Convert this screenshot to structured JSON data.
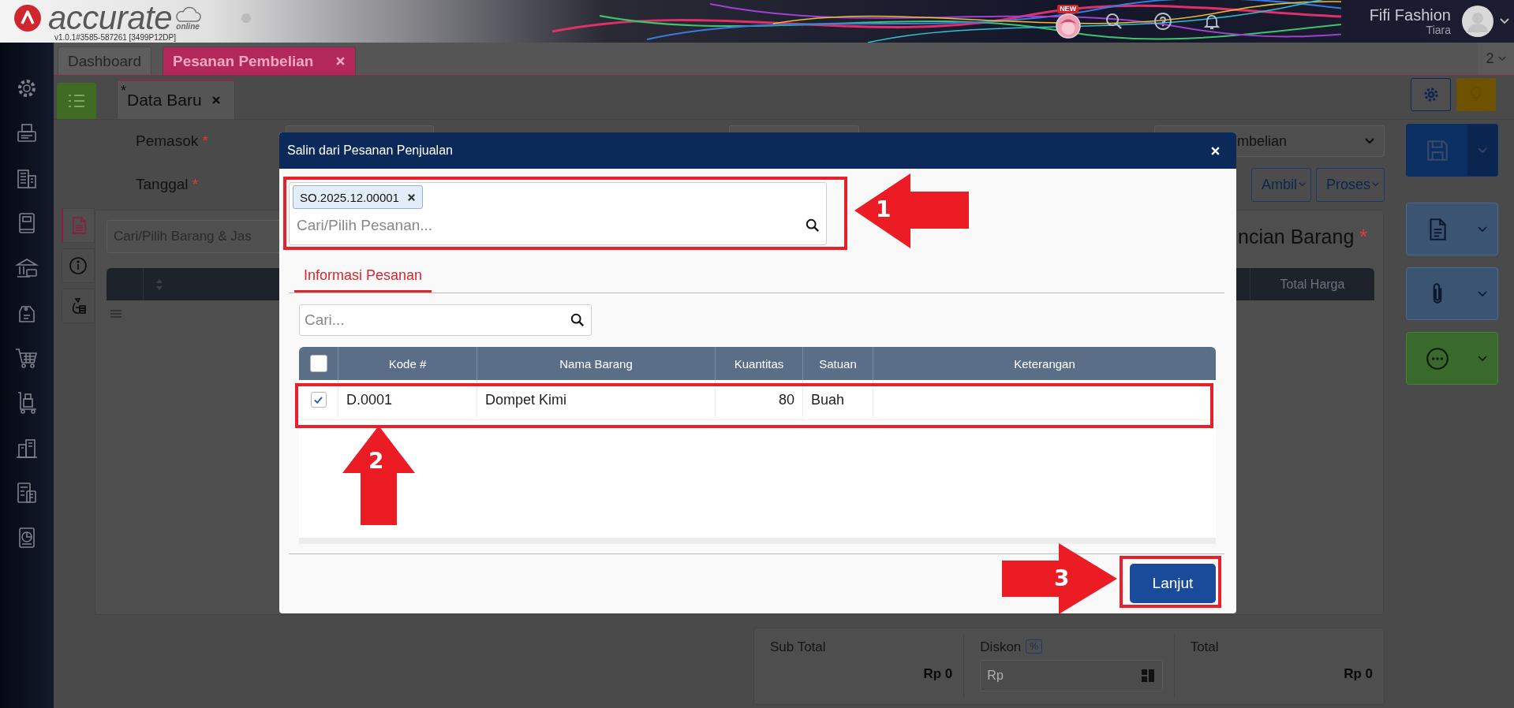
{
  "header": {
    "logo": "accurate",
    "logo_tagline": "online",
    "version": "v1.0.1#3585-587261 [3499P12DP]",
    "badge": "NEW",
    "company": "Fifi Fashion",
    "user": "Tiara"
  },
  "tabs": [
    {
      "label": "Dashboard",
      "selected": false,
      "closable": false
    },
    {
      "label": "Pesanan Pembelian",
      "selected": true,
      "closable": true
    }
  ],
  "open_tab_count": "2",
  "document_tab": {
    "mark": "*",
    "label": "Data Baru"
  },
  "form": {
    "fields": [
      {
        "label": "Pemasok",
        "mark": "*"
      },
      {
        "label": "Tanggal",
        "mark": "*"
      }
    ],
    "type_select": "mbelian",
    "actions": [
      "Ambil",
      "Proses"
    ]
  },
  "side_tabs": [
    {
      "kind": "document",
      "selected": true
    },
    {
      "kind": "info",
      "selected": false
    },
    {
      "kind": "money",
      "selected": false
    }
  ],
  "detail": {
    "search_placeholder": "Cari/Pilih Barang & Jas",
    "title": "ncian Barang",
    "mark": "*",
    "column": "Total Harga"
  },
  "totals": [
    {
      "kind": "amount",
      "label": "Sub Total",
      "value": "Rp 0"
    },
    {
      "kind": "discount",
      "label": "Diskon",
      "badge": "%",
      "placeholder": "Rp"
    },
    {
      "kind": "amount",
      "label": "Total",
      "value": "Rp 0"
    }
  ],
  "modal": {
    "title": "Salin dari Pesanan Penjualan",
    "order_field": {
      "chips": [
        "SO.2025.12.00001"
      ],
      "placeholder": "Cari/Pilih Pesanan...",
      "highlighted": true
    },
    "tabs": [
      {
        "label": "Informasi Pesanan",
        "selected": true
      }
    ],
    "search_placeholder": "Cari...",
    "table": {
      "select_all": false,
      "columns": [
        "Kode #",
        "Nama Barang",
        "Kuantitas",
        "Satuan",
        "Keterangan"
      ],
      "rows": [
        {
          "checked": true,
          "highlighted": true,
          "kode": "D.0001",
          "nama": "Dompet Kimi",
          "qty": "80",
          "unit": "Buah"
        }
      ]
    },
    "button": {
      "label": "Lanjut",
      "highlighted": true
    }
  },
  "annotations": [
    {
      "number": "1",
      "kind": "left"
    },
    {
      "number": "2",
      "kind": "up"
    },
    {
      "number": "3",
      "kind": "right"
    }
  ]
}
